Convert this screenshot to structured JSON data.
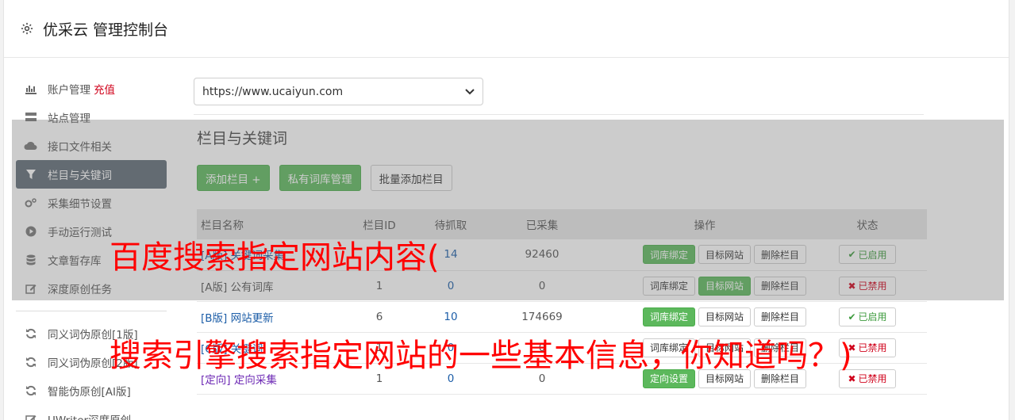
{
  "header": {
    "title": "优采云 管理控制台"
  },
  "sidebar": {
    "items": [
      {
        "label": "账户管理",
        "extra": "充值",
        "icon": "bar-chart-icon"
      },
      {
        "label": "站点管理",
        "icon": "server-icon"
      },
      {
        "label": "接口文件相关",
        "icon": "cloud-upload-icon"
      },
      {
        "label": "栏目与关键词",
        "icon": "filter-icon",
        "active": true
      },
      {
        "label": "采集细节设置",
        "icon": "cogs-icon"
      },
      {
        "label": "手动运行测试",
        "icon": "play-circle-icon"
      },
      {
        "label": "文章暂存库",
        "icon": "database-icon"
      },
      {
        "label": "深度原创任务",
        "icon": "edit-icon"
      }
    ],
    "items2": [
      {
        "label": "同义词伪原创[1版]",
        "icon": "refresh-icon"
      },
      {
        "label": "同义词伪原创[2版]",
        "icon": "refresh-icon"
      },
      {
        "label": "智能伪原创[AI版]",
        "icon": "refresh-icon"
      },
      {
        "label": "UWriter深度原创",
        "icon": "edit-icon"
      }
    ]
  },
  "main": {
    "site_select": "https://www.ucaiyun.com",
    "section_title": "栏目与关键词",
    "buttons": {
      "add": "添加栏目 +",
      "private": "私有词库管理",
      "batch": "批量添加栏目"
    },
    "table": {
      "headers": [
        "栏目名称",
        "栏目ID",
        "待抓取",
        "已采集",
        "操作",
        "状态"
      ],
      "rows": [
        {
          "name": "[A版] 关键词采集",
          "id": "1",
          "pending": "14",
          "collected": "92460",
          "ops": [
            "词库绑定",
            "目标网站",
            "删除栏目"
          ],
          "status": "已启用"
        },
        {
          "name": "[A版] 公有词库",
          "id": "1",
          "pending": "0",
          "collected": "0",
          "ops": [
            "词库绑定",
            "目标网站",
            "删除栏目"
          ],
          "status": "已禁用"
        },
        {
          "name": "[B版] 网站更新",
          "id": "6",
          "pending": "10",
          "collected": "174669",
          "ops": [
            "词库绑定",
            "目标网站",
            "删除栏目"
          ],
          "status": "已启用"
        },
        {
          "name": "[C版] 关键词",
          "id": "1",
          "pending": "0",
          "collected": "0",
          "ops": [
            "词库绑定",
            "目标网站",
            "删除栏目"
          ],
          "status": "已禁用"
        },
        {
          "name": "[定向] 定向采集",
          "id": "1",
          "pending": "0",
          "collected": "0",
          "ops": [
            "定向设置",
            "目标网站",
            "删除栏目"
          ],
          "status": "已禁用"
        }
      ]
    }
  },
  "overlay_text": {
    "line1": "百度搜索指定网站内容(",
    "line2": "搜索引擎搜索指定网站的一些基本信息，你知道吗？)"
  }
}
